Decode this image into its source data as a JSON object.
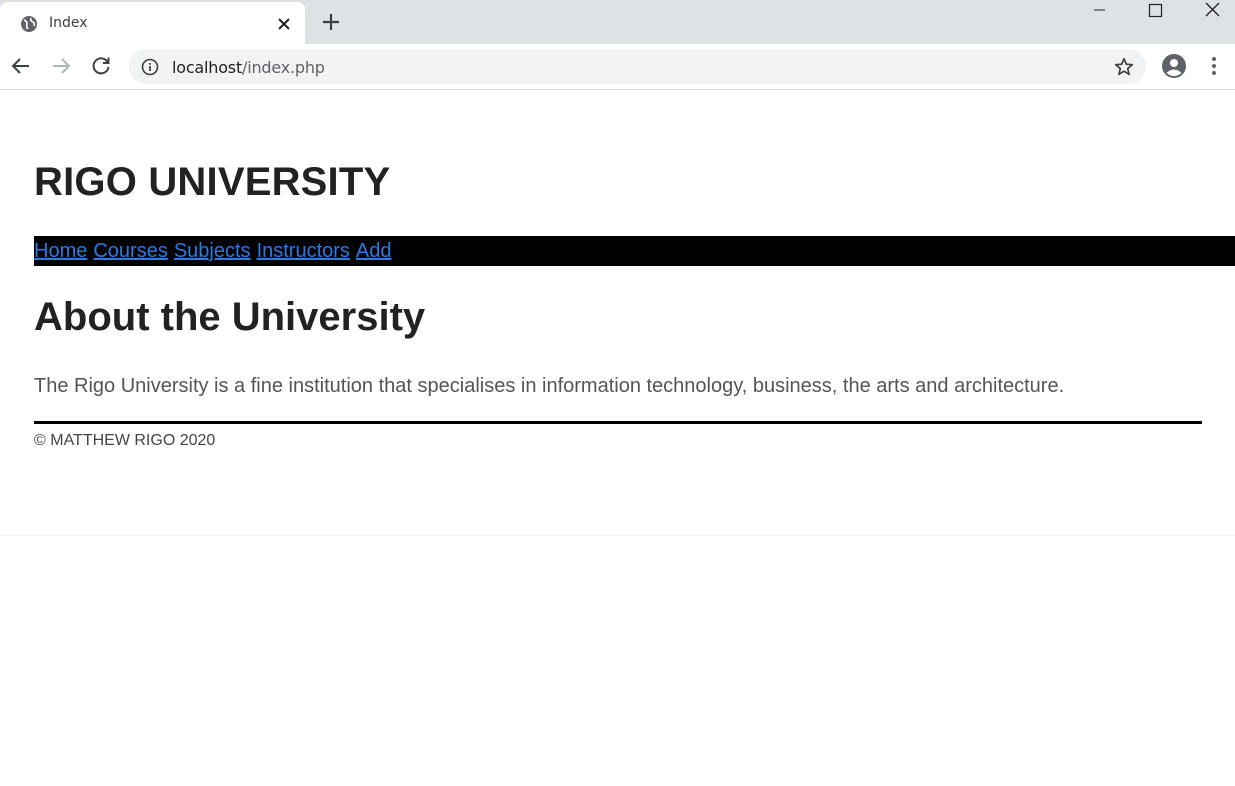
{
  "browser": {
    "tab_title": "Index",
    "url_host": "localhost",
    "url_path": "/index.php"
  },
  "site": {
    "title": "RIGO UNIVERSITY",
    "nav": [
      "Home",
      "Courses",
      "Subjects",
      "Instructors",
      "Add"
    ],
    "about_heading": "About the University",
    "about_text": "The Rigo University is a fine institution that specialises in information technology, business, the arts and architecture.",
    "footer": "© MATTHEW RIGO 2020"
  },
  "colors": {
    "link": "#2a7ae2",
    "nav_background": "#000000",
    "tabstrip": "#dee1e6"
  }
}
